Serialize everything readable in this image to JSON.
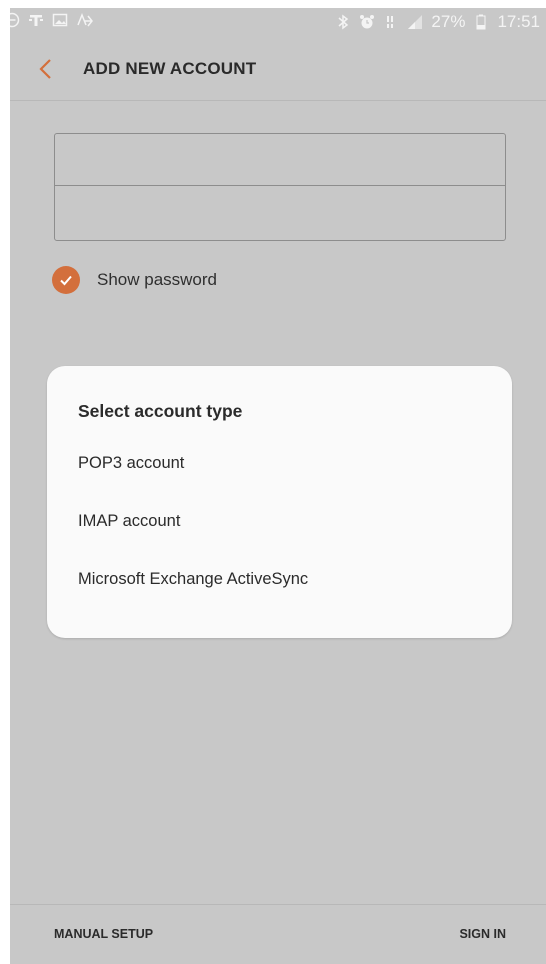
{
  "status_bar": {
    "left_icons": [
      "do-not-disturb-icon",
      "t-mobile-icon",
      "image-icon",
      "voicemail-icon"
    ],
    "right_icons": [
      "bluetooth-icon",
      "alarm-icon",
      "lte-icon",
      "signal-icon",
      "battery-icon"
    ],
    "battery": "27%",
    "time": "17:51"
  },
  "app_bar": {
    "back_icon": "chevron-left-icon",
    "title": "ADD NEW ACCOUNT",
    "accent": "#d36f3c"
  },
  "form": {
    "email_value": "",
    "password_value": "",
    "show_password_label": "Show password",
    "show_password_checked": true
  },
  "dialog": {
    "title": "Select account type",
    "options": [
      "POP3 account",
      "IMAP account",
      "Microsoft Exchange ActiveSync"
    ]
  },
  "bottom_bar": {
    "manual_setup": "MANUAL SETUP",
    "sign_in": "SIGN IN"
  }
}
